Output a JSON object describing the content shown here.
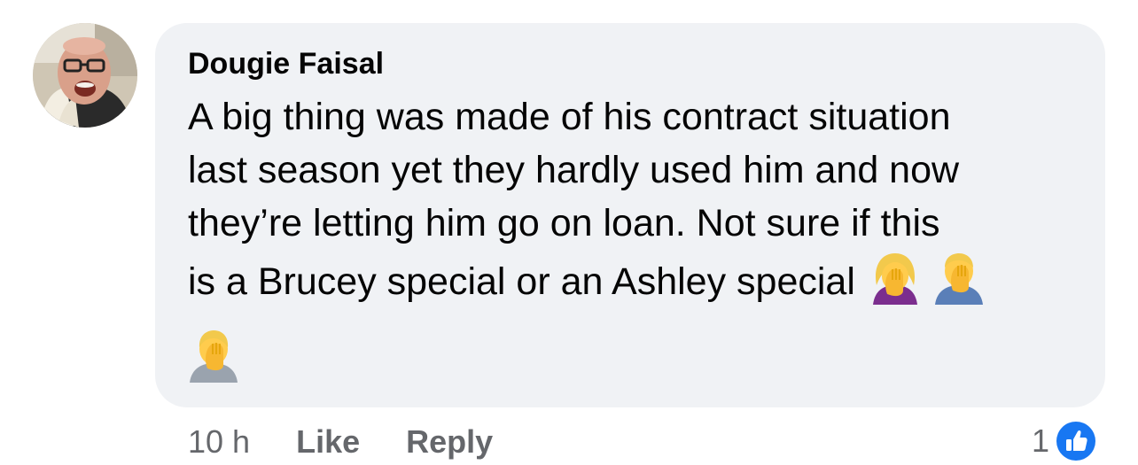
{
  "comment": {
    "author": "Dougie Faisal",
    "text_lines": [
      "A big thing was made of his contract situation",
      "last season yet they hardly used him and now",
      "they’re letting him go on loan. Not sure if this",
      "is a Brucey special or an Ashley special"
    ],
    "emojis": [
      "woman-facepalming-icon",
      "man-facepalming-icon",
      "person-facepalming-icon"
    ],
    "time": "10 h",
    "like_label": "Like",
    "reply_label": "Reply",
    "reaction_count": "1",
    "reaction_icon": "like-thumb-icon",
    "reaction_color": "#1877f2"
  }
}
